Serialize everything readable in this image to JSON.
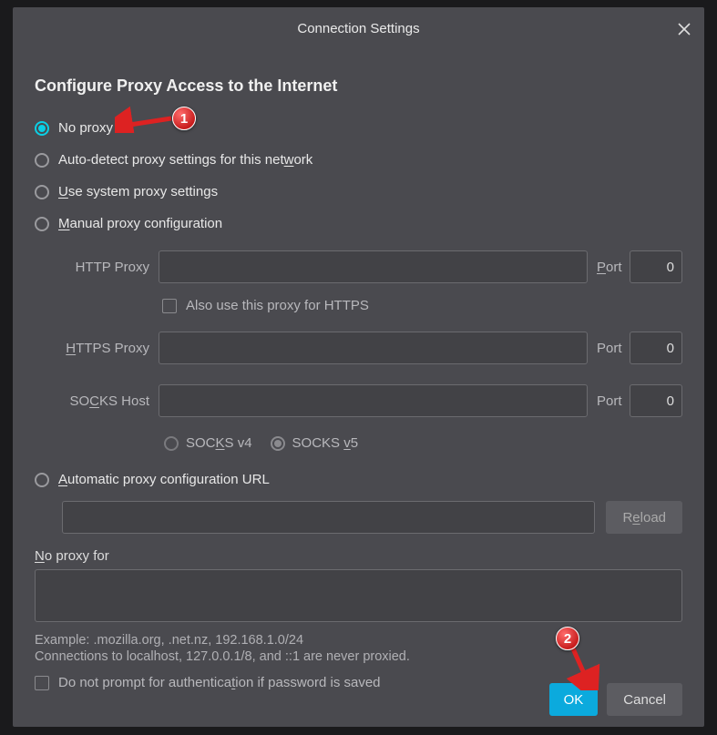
{
  "dialog": {
    "title": "Connection Settings",
    "heading": "Configure Proxy Access to the Internet"
  },
  "radios": {
    "no_proxy": "No proxy",
    "auto_detect_pre": "Auto-detect proxy settings for this net",
    "auto_detect_u": "w",
    "auto_detect_post": "ork",
    "use_system_u": "U",
    "use_system_post": "se system proxy settings",
    "manual_u": "M",
    "manual_post": "anual proxy configuration",
    "auto_url_u": "A",
    "auto_url_post": "utomatic proxy configuration URL"
  },
  "proxy": {
    "http_label": "HTTP Proxy",
    "http_value": "",
    "http_port": "0",
    "also_https": "Also use this proxy for HTTPS",
    "https_label_u": "H",
    "https_label_post": "TTPS Proxy",
    "https_value": "",
    "https_port": "0",
    "socks_label_pre": "SO",
    "socks_label_u": "C",
    "socks_label_post": "KS Host",
    "socks_value": "",
    "socks_port": "0",
    "port_label_u": "P",
    "port_label_post": "ort",
    "socks_v4_pre": "SOC",
    "socks_v4_u": "K",
    "socks_v4_post": "S v4",
    "socks_v5_pre": "SOCKS ",
    "socks_v5_u": "v",
    "socks_v5_post": "5"
  },
  "autourl": {
    "value": "",
    "reload_pre": "R",
    "reload_u": "e",
    "reload_post": "load"
  },
  "noproxyfor": {
    "label_u": "N",
    "label_post": "o proxy for",
    "value": "",
    "hint1": "Example: .mozilla.org, .net.nz, 192.168.1.0/24",
    "hint2": "Connections to localhost, 127.0.0.1/8, and ::1 are never proxied."
  },
  "auth_check_pre": "Do not prompt for authentica",
  "auth_check_u": "t",
  "auth_check_post": "ion if password is saved",
  "footer": {
    "ok": "OK",
    "cancel": "Cancel"
  },
  "annotations": {
    "one": "1",
    "two": "2"
  }
}
